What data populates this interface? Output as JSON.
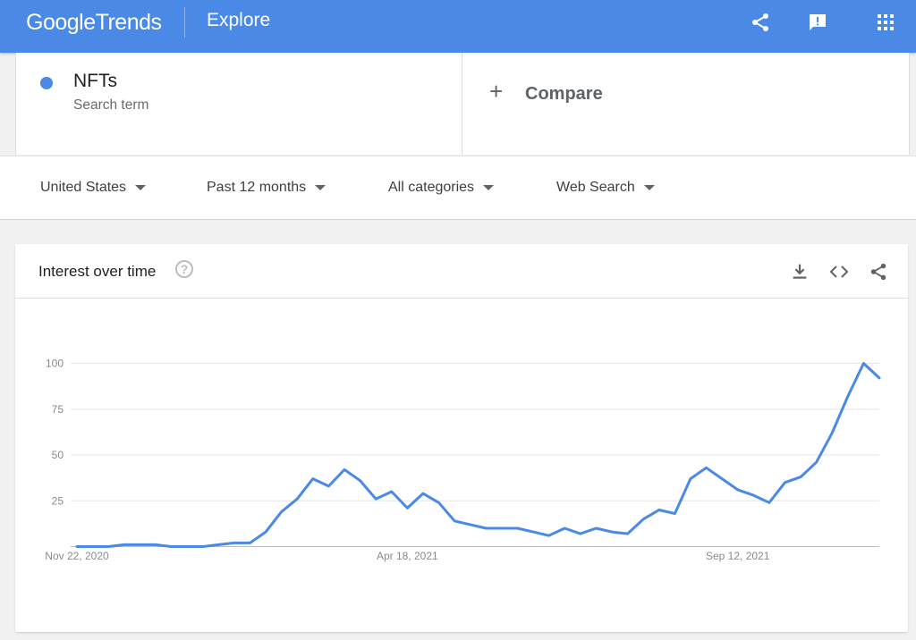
{
  "app": {
    "logo_google": "Google",
    "logo_trends": "Trends",
    "page_title": "Explore"
  },
  "search_term": {
    "name": "NFTs",
    "subtitle": "Search term",
    "color": "#4a89e5"
  },
  "compare": {
    "label": "Compare"
  },
  "filters": {
    "region": "United States",
    "time_range": "Past 12 months",
    "category": "All categories",
    "property": "Web Search"
  },
  "card": {
    "title": "Interest over time"
  },
  "icons": {
    "top": [
      "share-icon",
      "feedback-icon",
      "apps-grid-icon"
    ],
    "card": [
      "help-icon",
      "download-icon",
      "embed-code-icon",
      "share-icon"
    ]
  },
  "chart_data": {
    "type": "line",
    "title": "",
    "xlabel": "",
    "ylabel": "",
    "ylim": [
      0,
      100
    ],
    "yticks": [
      25,
      50,
      75,
      100
    ],
    "xtick_labels": [
      "Nov 22, 2020",
      "Apr 18, 2021",
      "Sep 12, 2021"
    ],
    "xtick_indices": [
      0,
      21,
      42
    ],
    "grid": true,
    "line_color": "#4a89e5",
    "series": [
      {
        "name": "NFTs",
        "values": [
          0,
          0,
          0,
          1,
          1,
          1,
          0,
          0,
          0,
          1,
          2,
          2,
          8,
          19,
          26,
          37,
          33,
          42,
          36,
          26,
          30,
          21,
          29,
          24,
          14,
          12,
          10,
          10,
          10,
          8,
          6,
          10,
          7,
          10,
          8,
          7,
          15,
          20,
          18,
          37,
          43,
          37,
          31,
          28,
          24,
          35,
          38,
          46,
          62,
          82,
          100,
          92
        ]
      }
    ]
  }
}
